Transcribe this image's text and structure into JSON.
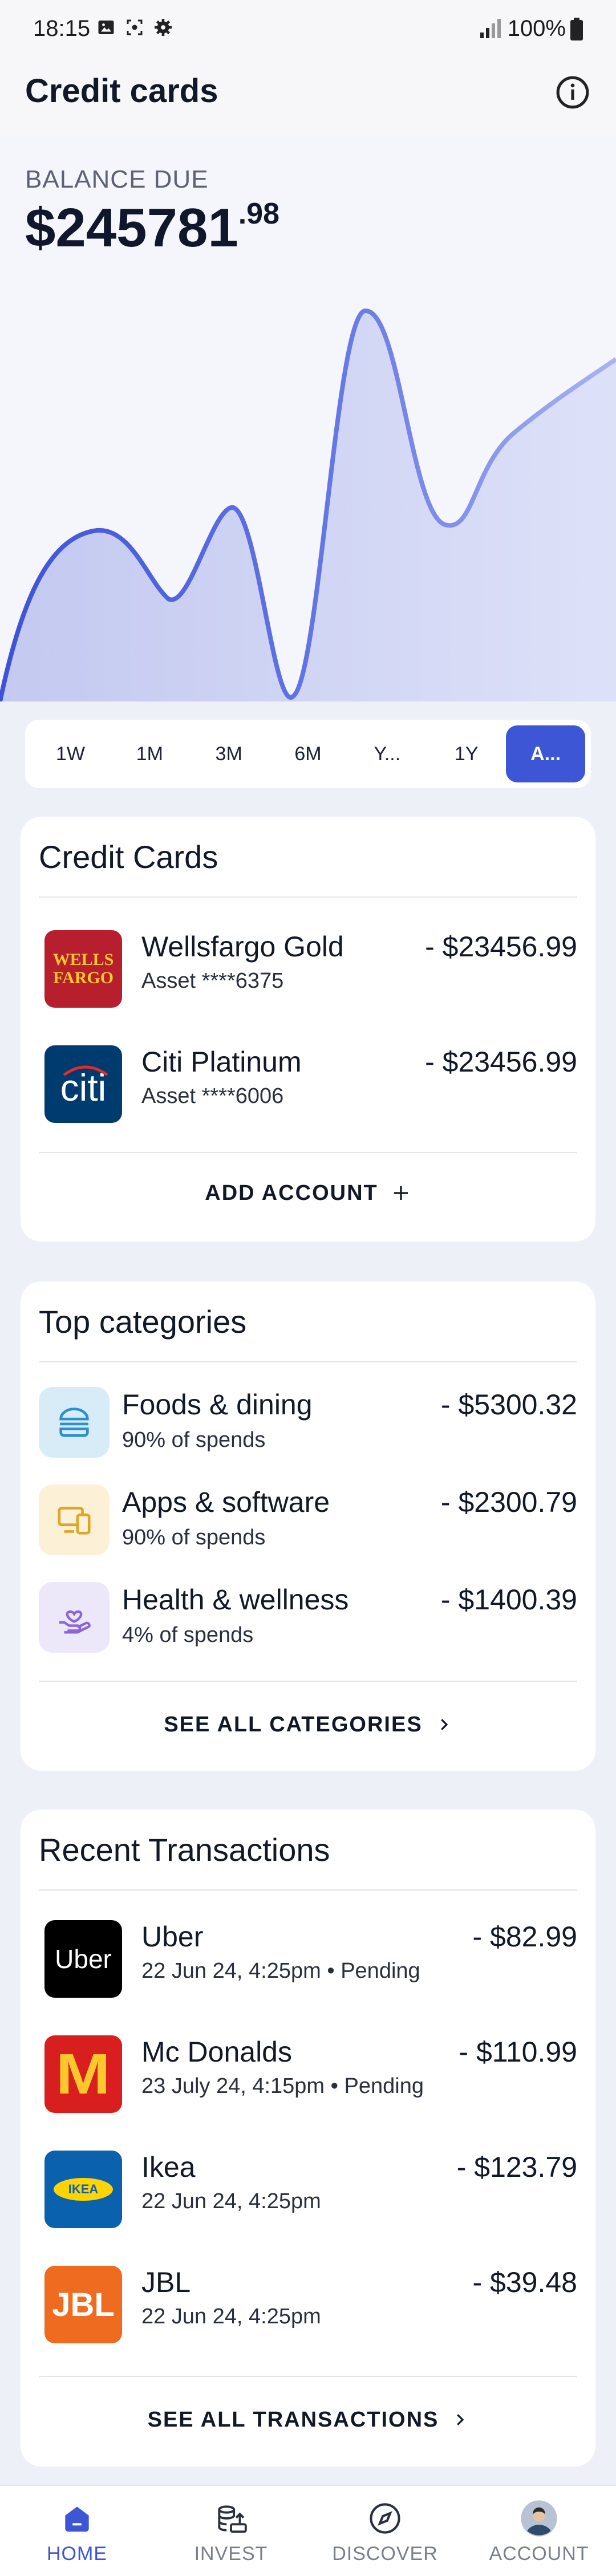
{
  "status_bar": {
    "time": "18:15",
    "battery": "100%"
  },
  "app_bar": {
    "title": "Credit cards"
  },
  "balance": {
    "label": "BALANCE DUE",
    "amount": "$245781",
    "cents": ".98"
  },
  "range_tabs": [
    {
      "label": "1W",
      "active": false
    },
    {
      "label": "1M",
      "active": false
    },
    {
      "label": "3M",
      "active": false
    },
    {
      "label": "6M",
      "active": false
    },
    {
      "label": "Y...",
      "active": false
    },
    {
      "label": "1Y",
      "active": false
    },
    {
      "label": "A...",
      "active": true
    }
  ],
  "credit_cards": {
    "title": "Credit Cards",
    "items": [
      {
        "name": "Wellsfargo Gold",
        "sub": "Asset ****6375",
        "amount": "- $23456.99",
        "logo": "wells-fargo-logo",
        "logo_text": [
          "WELLS",
          "FARGO"
        ],
        "logo_color": "#b71f2e"
      },
      {
        "name": "Citi Platinum",
        "sub": "Asset ****6006",
        "amount": "- $23456.99",
        "logo": "citi-logo",
        "logo_text": [
          "citi"
        ],
        "logo_color": "#003b70"
      }
    ],
    "action": "ADD ACCOUNT"
  },
  "categories": {
    "title": "Top categories",
    "items": [
      {
        "name": "Foods & dining",
        "sub": "90% of spends",
        "amount": "- $5300.32",
        "icon": "burger-icon",
        "bg": "#d8ecf8"
      },
      {
        "name": "Apps & software",
        "sub": "90% of spends",
        "amount": "- $2300.79",
        "icon": "devices-icon",
        "bg": "#fcf0d6"
      },
      {
        "name": "Health & wellness",
        "sub": "4% of spends",
        "amount": "- $1400.39",
        "icon": "heart-hand-icon",
        "bg": "#ece8fa"
      }
    ],
    "action": "SEE ALL CATEGORIES"
  },
  "transactions": {
    "title": "Recent Transactions",
    "items": [
      {
        "name": "Uber",
        "sub": "22 Jun 24, 4:25pm • Pending",
        "amount": "- $82.99",
        "logo": "uber-logo",
        "logo_text": "Uber",
        "logo_color": "#000000"
      },
      {
        "name": "Mc Donalds",
        "sub": "23 July 24, 4:15pm • Pending",
        "amount": "- $110.99",
        "logo": "mcdonalds-logo",
        "logo_text": "M",
        "logo_color": "#d81e1e"
      },
      {
        "name": "Ikea",
        "sub": "22 Jun 24, 4:25pm",
        "amount": "- $123.79",
        "logo": "ikea-logo",
        "logo_text": "IKEA",
        "logo_color": "#0a62ae"
      },
      {
        "name": "JBL",
        "sub": "22 Jun 24, 4:25pm",
        "amount": "- $39.48",
        "logo": "jbl-logo",
        "logo_text": "JBL",
        "logo_color": "#ee6b1f"
      }
    ],
    "action": "SEE ALL TRANSACTIONS"
  },
  "bottom_nav": [
    {
      "label": "HOME",
      "icon": "home-icon",
      "active": true
    },
    {
      "label": "INVEST",
      "icon": "invest-icon",
      "active": false
    },
    {
      "label": "DISCOVER",
      "icon": "compass-icon",
      "active": false
    },
    {
      "label": "ACCOUNT",
      "icon": "avatar-icon",
      "active": false
    }
  ],
  "colors": {
    "accent": "#3d56d6",
    "chart_fill": "#c9cff3",
    "chart_line": "#4a5fe0"
  }
}
